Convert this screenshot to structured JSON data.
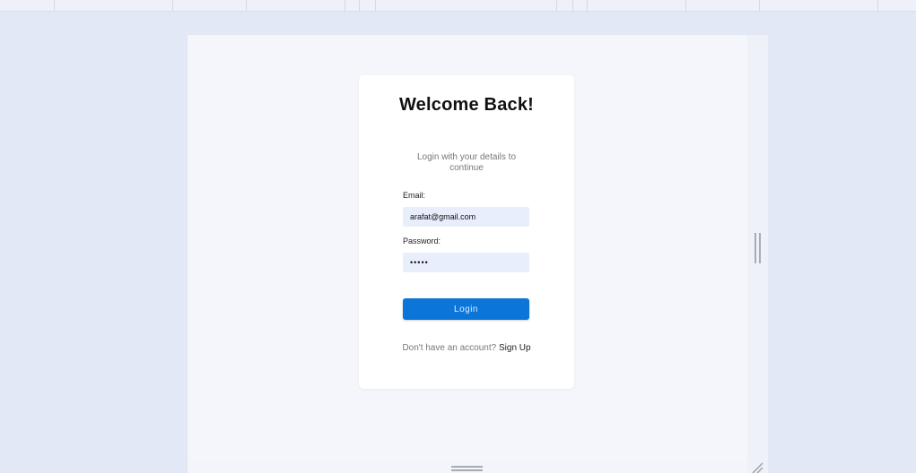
{
  "login": {
    "title": "Welcome Back!",
    "subtitle": "Login with your details to continue",
    "email_label": "Email:",
    "email_value": "arafat@gmail.com",
    "password_label": "Password:",
    "password_value": "abcde",
    "login_button": "Login",
    "signup_prompt": "Don't have an account?",
    "signup_link": "Sign Up"
  },
  "colors": {
    "background": "#e3e8f6",
    "card": "#ffffff",
    "input_bg": "#e8eefc",
    "primary_button": "#0b76d8"
  }
}
